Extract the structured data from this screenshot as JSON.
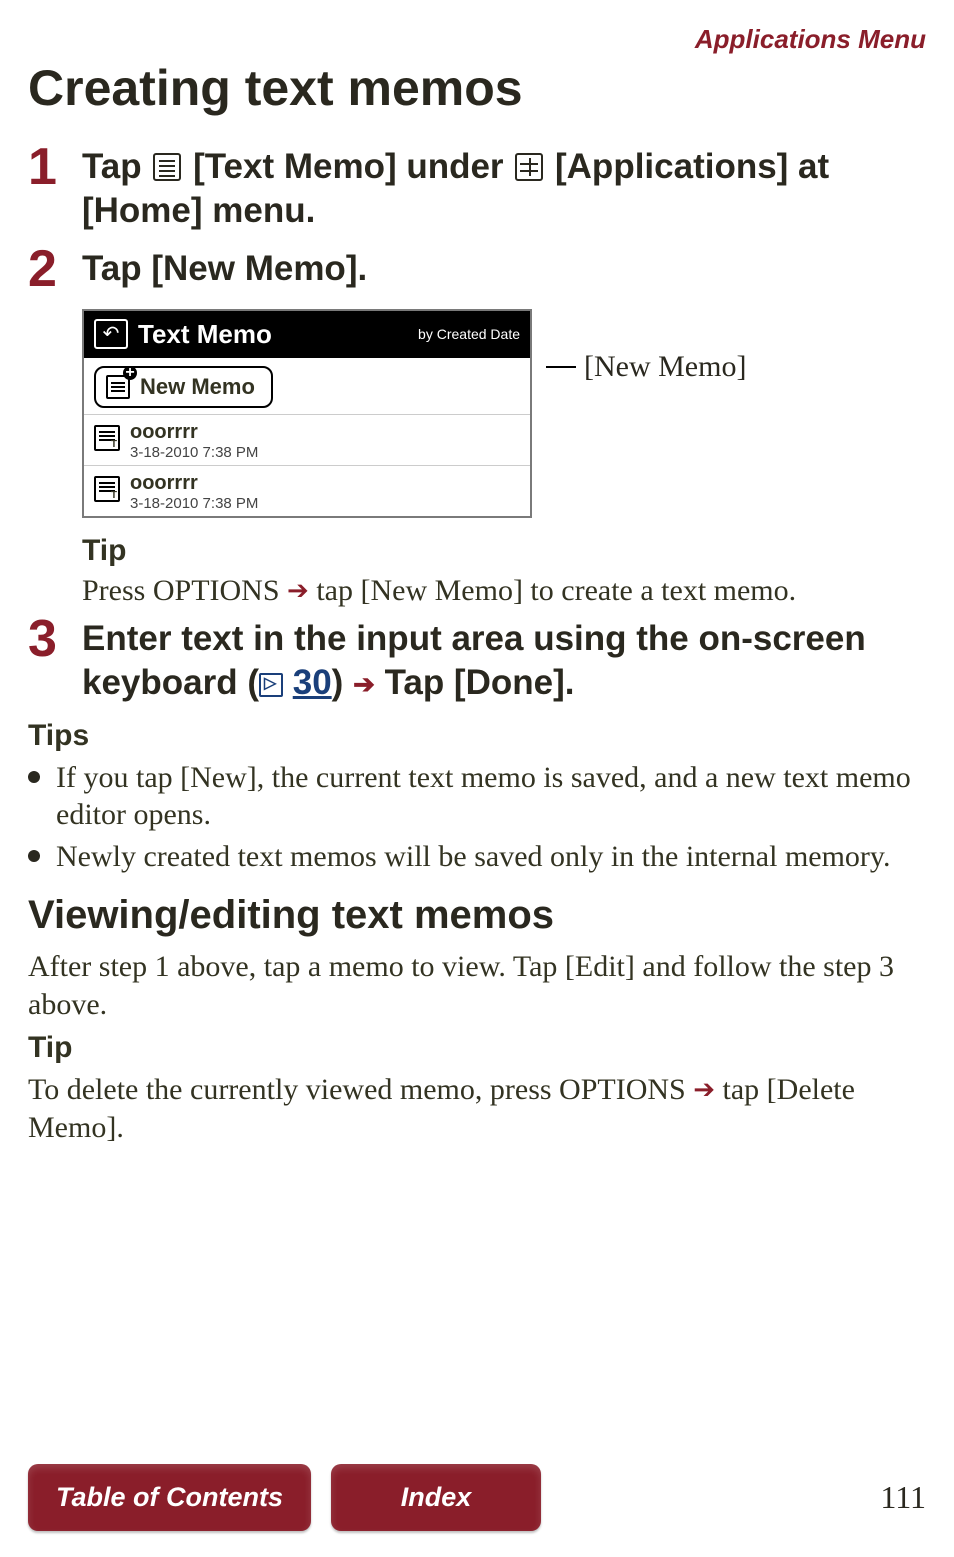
{
  "header_nav": "Applications Menu",
  "title": "Creating text memos",
  "steps": {
    "s1": {
      "num": "1",
      "pre": "Tap ",
      "a": " [Text Memo] under ",
      "b": " [Applications] at [Home] menu."
    },
    "s2": {
      "num": "2",
      "text": "Tap [New Memo]."
    },
    "s3": {
      "num": "3",
      "pre": "Enter text in the input area using the on-screen keyboard (",
      "ref": "30",
      "post": ") ",
      "tail": " Tap [Done]."
    }
  },
  "screenshot": {
    "title": "Text Memo",
    "sort": "by Created Date",
    "new_label": "New Memo",
    "rows": [
      {
        "title": "ooorrrr",
        "date": "3-18-2010 7:38 PM"
      },
      {
        "title": "ooorrrr",
        "date": "3-18-2010 7:38 PM"
      }
    ],
    "callout": "[New Memo]"
  },
  "tip_head": "Tip",
  "tip1_pre": "Press OPTIONS ",
  "tip1_post": " tap [New Memo] to create a text memo.",
  "tips_head": "Tips",
  "tips": [
    "If you tap [New], the current text memo is saved, and a new text memo editor opens.",
    "Newly created text memos will be saved only in the internal memory."
  ],
  "subsection": "Viewing/editing text memos",
  "view_text": "After step 1 above, tap a memo to view. Tap [Edit] and follow the step 3 above.",
  "tip2_head": "Tip",
  "tip2_pre": "To delete the currently viewed memo, press OPTIONS ",
  "tip2_post": " tap [Delete Memo].",
  "footer": {
    "toc": "Table of Contents",
    "index": "Index",
    "page": "111"
  }
}
